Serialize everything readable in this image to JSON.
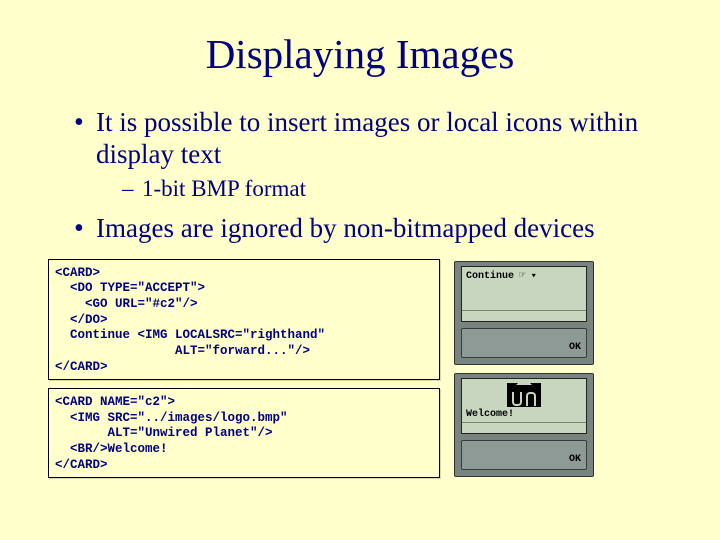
{
  "title": "Displaying Images",
  "bullets": {
    "b1": "It  is possible to insert images or local icons within display text",
    "b1_sub": "1-bit BMP format",
    "b2": "Images are ignored by non-bitmapped devices"
  },
  "code": {
    "block1": "<CARD>\n  <DO TYPE=\"ACCEPT\">\n    <GO URL=\"#c2\"/>\n  </DO>\n  Continue <IMG LOCALSRC=\"righthand\"\n                ALT=\"forward...\"/>\n</CARD>",
    "block2": "<CARD NAME=\"c2\">\n  <IMG SRC=\"../images/logo.bmp\"\n       ALT=\"Unwired Planet\"/>\n  <BR/>Welcome!\n</CARD>"
  },
  "screens": {
    "s1": {
      "text": "Continue",
      "ok": "OK"
    },
    "s2": {
      "welcome": "Welcome!",
      "ok": "OK"
    }
  }
}
